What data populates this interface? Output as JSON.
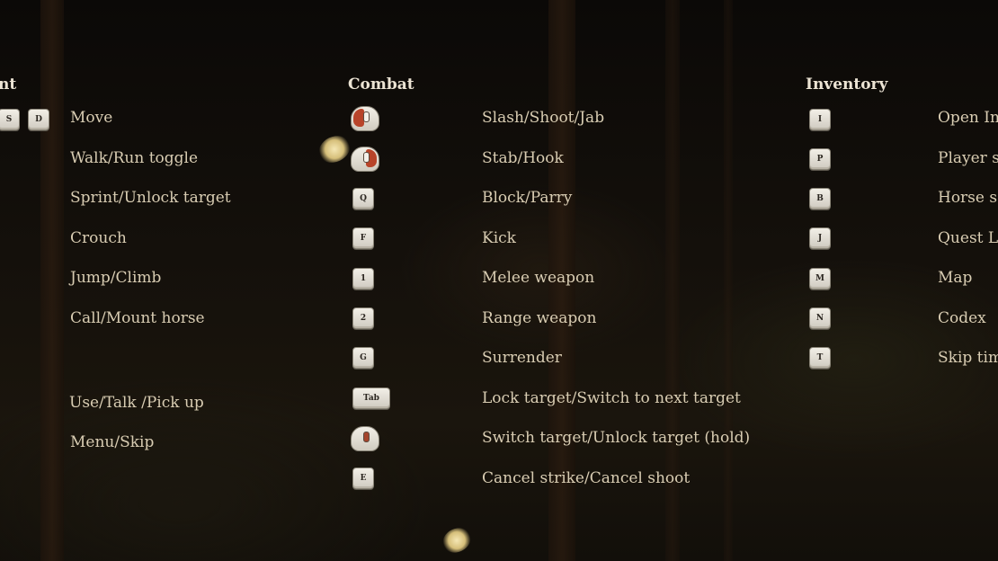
{
  "movement": {
    "title": "nt",
    "keys": [
      "S",
      "D"
    ],
    "actions": [
      "Move",
      "Walk/Run toggle",
      "Sprint/Unlock target",
      "Crouch",
      "Jump/Climb",
      "Call/Mount horse",
      "Use/Talk /Pick up",
      "Menu/Skip"
    ]
  },
  "combat": {
    "title": "Combat",
    "keys": [
      "Q",
      "F",
      "1",
      "2",
      "G",
      "Tab",
      "E"
    ],
    "actions": [
      "Slash/Shoot/Jab",
      "Stab/Hook",
      "Block/Parry",
      "Kick",
      "Melee weapon",
      "Range weapon",
      "Surrender",
      "Lock target/Switch to next target",
      "Switch target/Unlock target (hold)",
      "Cancel strike/Cancel shoot"
    ],
    "mouse_icons": [
      "mouse-left-click-icon",
      "mouse-right-click-icon",
      "mouse-middle-click-icon"
    ]
  },
  "inventory": {
    "title": "Inventory",
    "keys": [
      "I",
      "P",
      "B",
      "J",
      "M",
      "N",
      "T"
    ],
    "actions": [
      "Open In",
      "Player s",
      "Horse s",
      "Quest L",
      "Map",
      "Codex",
      "Skip tim"
    ]
  },
  "colors": {
    "title_text": "#ece4d4",
    "action_text": "#d9cdb3",
    "mouse_button_accent": "#b8442a",
    "keycap": "#e6e2d8"
  }
}
